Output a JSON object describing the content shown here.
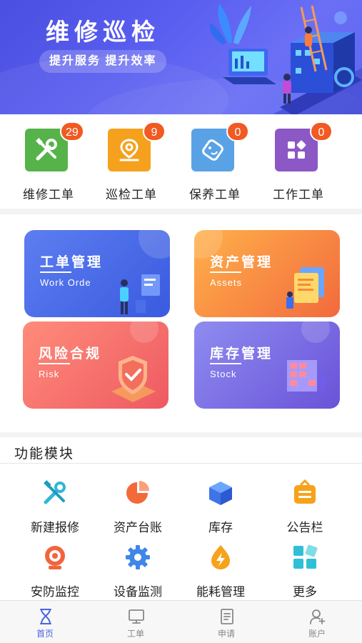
{
  "banner": {
    "title": "维修巡检",
    "slogan": "提升服务  提升效率"
  },
  "quick_orders": [
    {
      "label": "维修工单",
      "count": "29",
      "icon": "tools-icon",
      "color": "#56b34a"
    },
    {
      "label": "巡检工单",
      "count": "9",
      "icon": "location-pin-icon",
      "color": "#f5a11e"
    },
    {
      "label": "保养工单",
      "count": "0",
      "icon": "maintenance-tag-icon",
      "color": "#5aa2e6"
    },
    {
      "label": "工作工单",
      "count": "0",
      "icon": "app-grid-icon",
      "color": "#8b58c6"
    }
  ],
  "modules": [
    {
      "title": "工单管理",
      "subtitle": "Work Orde",
      "icon": "person-screen-icon"
    },
    {
      "title": "资产管理",
      "subtitle": "Assets",
      "icon": "documents-icon"
    },
    {
      "title": "风险合规",
      "subtitle": "Risk",
      "icon": "shield-check-icon"
    },
    {
      "title": "库存管理",
      "subtitle": "Stock",
      "icon": "warehouse-icon"
    }
  ],
  "functions": {
    "title": "功能模块",
    "items": [
      {
        "label": "新建报修",
        "icon": "wrench-hammer-icon"
      },
      {
        "label": "资产台账",
        "icon": "pie-chart-icon"
      },
      {
        "label": "库存",
        "icon": "box-icon"
      },
      {
        "label": "公告栏",
        "icon": "notice-board-icon"
      },
      {
        "label": "安防监控",
        "icon": "camera-icon"
      },
      {
        "label": "设备监测",
        "icon": "gear-icon"
      },
      {
        "label": "能耗管理",
        "icon": "energy-icon"
      },
      {
        "label": "更多",
        "icon": "more-grid-icon"
      }
    ]
  },
  "tabbar": {
    "items": [
      {
        "label": "首页",
        "icon": "hourglass-icon",
        "active": true
      },
      {
        "label": "工单",
        "icon": "monitor-icon",
        "active": false
      },
      {
        "label": "申请",
        "icon": "document-icon",
        "active": false
      },
      {
        "label": "账户",
        "icon": "user-icon",
        "active": false
      }
    ]
  }
}
